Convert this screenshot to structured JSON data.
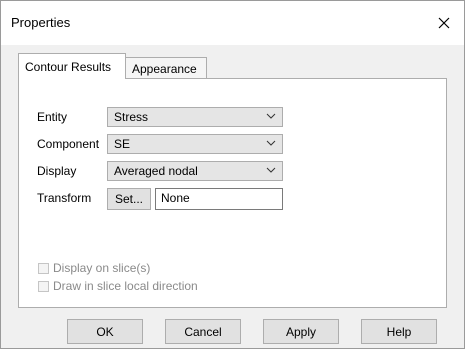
{
  "window": {
    "title": "Properties",
    "close_icon": "close-icon"
  },
  "tabs": [
    {
      "label": "Contour Results",
      "active": true
    },
    {
      "label": "Appearance",
      "active": false
    }
  ],
  "fields": {
    "entity": {
      "label": "Entity",
      "value": "Stress"
    },
    "component": {
      "label": "Component",
      "value": "SE"
    },
    "display": {
      "label": "Display",
      "value": "Averaged nodal"
    },
    "transform": {
      "label": "Transform",
      "button": "Set...",
      "value": "None"
    }
  },
  "checkboxes": [
    {
      "label": "Display on slice(s)",
      "checked": false,
      "enabled": false
    },
    {
      "label": "Draw in slice local direction",
      "checked": false,
      "enabled": false
    }
  ],
  "buttons": {
    "ok": "OK",
    "cancel": "Cancel",
    "apply": "Apply",
    "help": "Help"
  }
}
